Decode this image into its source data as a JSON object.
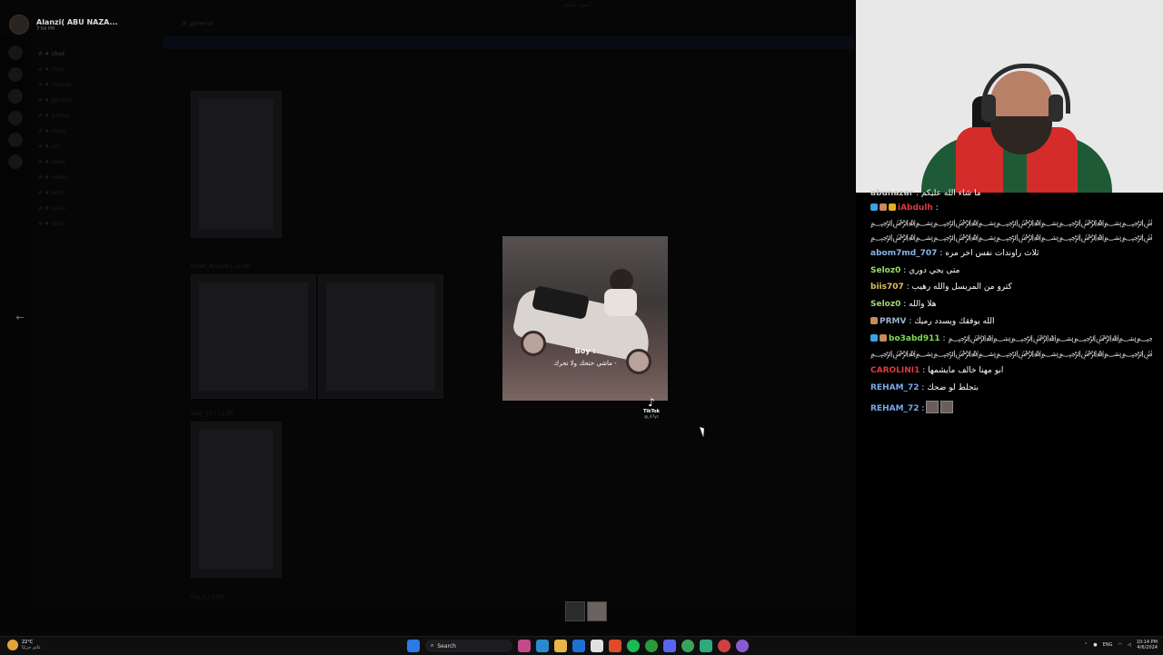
{
  "app": {
    "center_title": "انيمي عليكم",
    "dm": {
      "name": "Alanzi( ABU NAZA...",
      "time": "7:54 PM"
    },
    "channel_label": "# general",
    "thumb_captions": [
      "Iamm_Alanzi6 | 12:00",
      "user_12 | 12:30",
      "Fay_1 | 1:00"
    ],
    "channel_items": [
      "# ♦ chat",
      "# ♦ clips",
      "# ♦ memes",
      "# ♦ general",
      "# ♦ games",
      "# ♦ music",
      "# ♦ art",
      "# ♦ news",
      "# ♦ media",
      "# ♦ bots",
      "# ♦ voice",
      "# ♦ rules"
    ]
  },
  "viewer": {
    "caption_line1": "Boy :",
    "caption_line2": "ماشي حتحك ولا تحرك -",
    "tiktok_label": "TikTok",
    "tiktok_handle": "@_47yc",
    "prev_arrow": "←",
    "next_arrow": "→"
  },
  "chat": {
    "messages": [
      {
        "user": "abunazar",
        "color": "#c9c9c9",
        "text": " : ما شاء الله عليكم",
        "badges": []
      },
      {
        "user": "iAbdulh",
        "color": "#e03a3a",
        "text": " :",
        "badges": [
          "#3aa3e0",
          "#c98a5a",
          "#e0b020"
        ]
      },
      {
        "user": "",
        "color": "#ffffff",
        "text": "﷽﷽﷽﷽﷽﷽﷽﷽﷽﷽﷽﷽﷽﷽﷽﷽﷽﷽﷽﷽﷽﷽﷽﷽﷽﷽",
        "badges": []
      },
      {
        "user": "",
        "color": "#ffffff",
        "text": "﷽﷽﷽﷽﷽﷽﷽﷽﷽﷽﷽﷽﷽﷽﷽﷽﷽﷽﷽﷽﷽﷽﷽﷽﷽﷽",
        "badges": []
      },
      {
        "user": "abom7md_707",
        "color": "#8ab4e8",
        "text": " : ثلاث راوندات نفس اخر مره",
        "badges": []
      },
      {
        "user": "Seloz0",
        "color": "#9ad96b",
        "text": " : متى يجي دوري",
        "badges": []
      },
      {
        "user": "biis707",
        "color": "#e0c060",
        "text": " : كترو من المريسل والله رهيب",
        "badges": []
      },
      {
        "user": "Seloz0",
        "color": "#9ad96b",
        "text": " : هلا والله",
        "badges": []
      },
      {
        "user": "PRMV",
        "color": "#9fb0d0",
        "text": " : الله يوفقك ويسدد رميك",
        "badges": [
          "#c98a5a"
        ]
      },
      {
        "user": "bo3abd911",
        "color": "#7ed957",
        "text": " : ﷽﷽﷽﷽﷽﷽﷽﷽﷽﷽﷽﷽﷽﷽﷽﷽﷽",
        "badges": [
          "#3aa3e0",
          "#c98a5a"
        ]
      },
      {
        "user": "",
        "color": "#ffffff",
        "text": "﷽﷽﷽﷽﷽﷽﷽﷽﷽﷽﷽﷽﷽﷽﷽﷽﷽﷽﷽﷽",
        "badges": []
      },
      {
        "user": "CAROLINI1",
        "color": "#e03a3a",
        "text": " : ابو مهنا خالف مايشمها",
        "badges": []
      },
      {
        "user": "REHAM_72",
        "color": "#7aa8e8",
        "text": " : بتجلط لو ضحك",
        "badges": []
      },
      {
        "user": "REHAM_72",
        "color": "#7aa8e8",
        "text": " :",
        "badges": [],
        "emotes": 2
      }
    ]
  },
  "taskbar": {
    "weather_temp": "22°C",
    "weather_desc": "غائم جزئيًا",
    "search_label": "Search",
    "lang": "ENG",
    "time": "10:14 PM",
    "date": "4/6/2024"
  }
}
